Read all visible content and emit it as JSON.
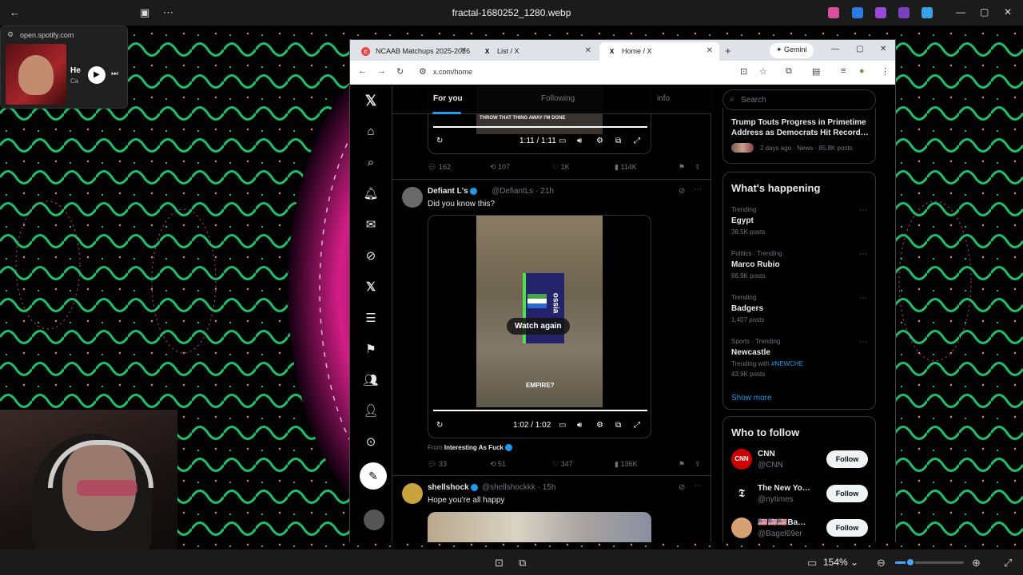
{
  "viewer": {
    "title": "fractal-1680252_1280.webp",
    "zoom": "154%",
    "zoom_level": 0.22,
    "icons": [
      "back-icon",
      "slideshow-icon",
      "more-icon",
      "fit-icon",
      "zoom-out-icon",
      "zoom-in-icon",
      "expand-icon"
    ]
  },
  "spotify": {
    "url": "open.spotify.com",
    "title": "He",
    "subtitle": "Ca"
  },
  "browser": {
    "tabs": [
      {
        "label": "NCAAB Matchups 2025-2026",
        "icon": "c"
      },
      {
        "label": "List / X",
        "icon": "X"
      },
      {
        "label": "Home / X",
        "icon": "X"
      }
    ],
    "gemini": "Gemini",
    "url": "x.com/home"
  },
  "feed": {
    "tabs": [
      "For you",
      "Following",
      "info"
    ],
    "video1": {
      "caption": "THROW THAT THING AWAY I'M DONE",
      "time": "1:11 / 1:11"
    },
    "post1_actions": {
      "replies": "162",
      "reposts": "107",
      "likes": "1K",
      "views": "114K"
    },
    "post2": {
      "name": "Defiant L's",
      "handle": "@DefiantLs · 21h",
      "text": "Did you know this?",
      "map_label": "ossia",
      "overlay": "Watch again",
      "subtitle": "EMPIRE?",
      "time": "1:02 / 1:02",
      "from_prefix": "From",
      "from_name": "Interesting As Fuck",
      "actions": {
        "replies": "33",
        "reposts": "51",
        "likes": "347",
        "views": "136K"
      }
    },
    "post3": {
      "name": "shellshock",
      "handle": "@shellshockkk · 15h",
      "text": "Hope you're all happy"
    }
  },
  "sidebar": {
    "search_placeholder": "Search",
    "news": {
      "title": "Trump Touts Progress in Primetime Address as Democrats Hit Record…",
      "meta": "2 days ago · News · 85.8K posts"
    },
    "happening_title": "What's happening",
    "trends": [
      {
        "category": "Trending",
        "name": "Egypt",
        "count": "38.5K posts"
      },
      {
        "category": "Politics · Trending",
        "name": "Marco Rubio",
        "count": "86.9K posts"
      },
      {
        "category": "Trending",
        "name": "Badgers",
        "count": "1,407 posts"
      },
      {
        "category": "Sports · Trending",
        "name": "Newcastle",
        "extra_prefix": "Trending with",
        "extra_tag": "#NEWCHE",
        "count": "43.9K posts"
      }
    ],
    "show_more": "Show more",
    "who_to_follow": "Who to follow",
    "follows": [
      {
        "name": "CNN",
        "handle": "@CNN",
        "button": "Follow"
      },
      {
        "name": "The New Yo…",
        "handle": "@nytimes",
        "button": "Follow"
      },
      {
        "name": "🇺🇸🇺🇸🇺🇸Ba…",
        "handle": "@Bagel69er",
        "button": "Follow"
      }
    ]
  },
  "colors": {
    "accent": "#1d9bf0",
    "background": "#000000",
    "border": "#2f3336"
  }
}
